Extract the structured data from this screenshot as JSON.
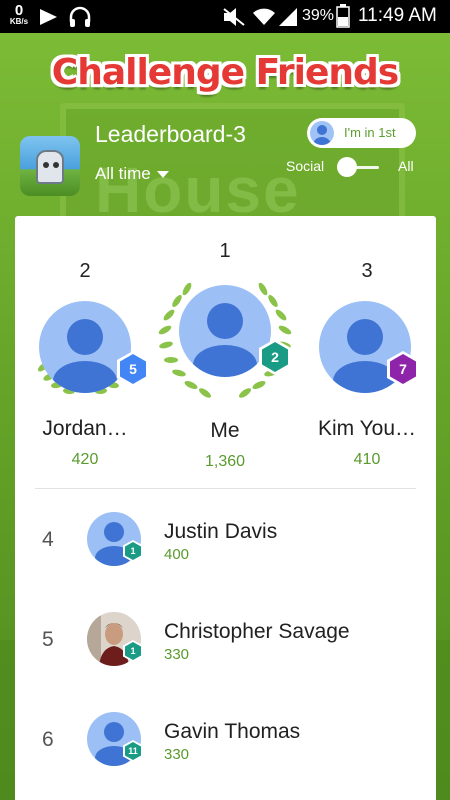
{
  "status_bar": {
    "network_speed": "0",
    "network_unit": "KB/s",
    "battery_percent": "39%",
    "time": "11:49 AM"
  },
  "title": "Challenge Friends",
  "leaderboard": {
    "name": "Leaderboard-3",
    "time_filter": "All time",
    "my_rank_label": "I'm in 1st",
    "toggle_left": "Social",
    "toggle_right": "All"
  },
  "top_three": [
    {
      "rank": "2",
      "name": "Jordan…",
      "score": "420",
      "level": "5",
      "level_color": "#4285f4"
    },
    {
      "rank": "1",
      "name": "Me",
      "score": "1,360",
      "level": "2",
      "level_color": "#1a9b86"
    },
    {
      "rank": "3",
      "name": "Kim You…",
      "score": "410",
      "level": "7",
      "level_color": "#8e24aa"
    }
  ],
  "rows": [
    {
      "rank": "4",
      "name": "Justin Davis",
      "score": "400",
      "level": "1",
      "avatar": "default-avatar"
    },
    {
      "rank": "5",
      "name": "Christopher Savage",
      "score": "330",
      "level": "1",
      "avatar": "profile-photo"
    },
    {
      "rank": "6",
      "name": "Gavin Thomas",
      "score": "330",
      "level": "11",
      "avatar": "default-avatar"
    }
  ],
  "colors": {
    "accent_green": "#5a9a2e",
    "badge_green": "#1a9b86",
    "avatar_blue": "#3f73d4",
    "title_red": "#e53935"
  }
}
